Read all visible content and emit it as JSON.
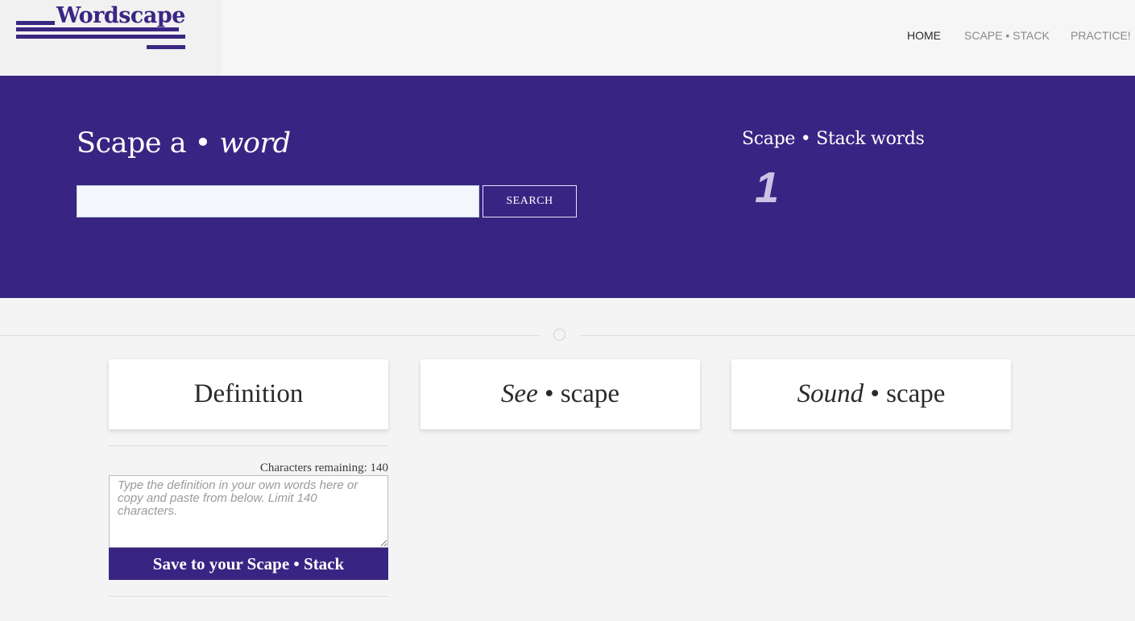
{
  "app": {
    "logo_text": "Wordscape"
  },
  "nav": {
    "items": [
      {
        "label": "HOME"
      },
      {
        "label": "SCAPE • STACK"
      },
      {
        "label": "PRACTICE!"
      }
    ]
  },
  "hero": {
    "title_prefix": "Scape a • ",
    "title_italic": "word",
    "search_input_value": "",
    "search_button_label": "SEARCH",
    "stack_title": "Scape • Stack words",
    "stack_count": "1"
  },
  "cards": {
    "definition": "Definition",
    "see_italic": "See",
    "see_rest": " • scape",
    "sound_italic": "Sound",
    "sound_rest": " • scape"
  },
  "definition_form": {
    "chars_remaining": "Characters remaining: 140",
    "textarea_placeholder": "Type the definition in your own words here or copy and paste from below. Limit 140 characters.",
    "save_button_label": "Save to your Scape • Stack"
  },
  "colors": {
    "brand": "#382583",
    "page_background": "#f4f4f4"
  }
}
